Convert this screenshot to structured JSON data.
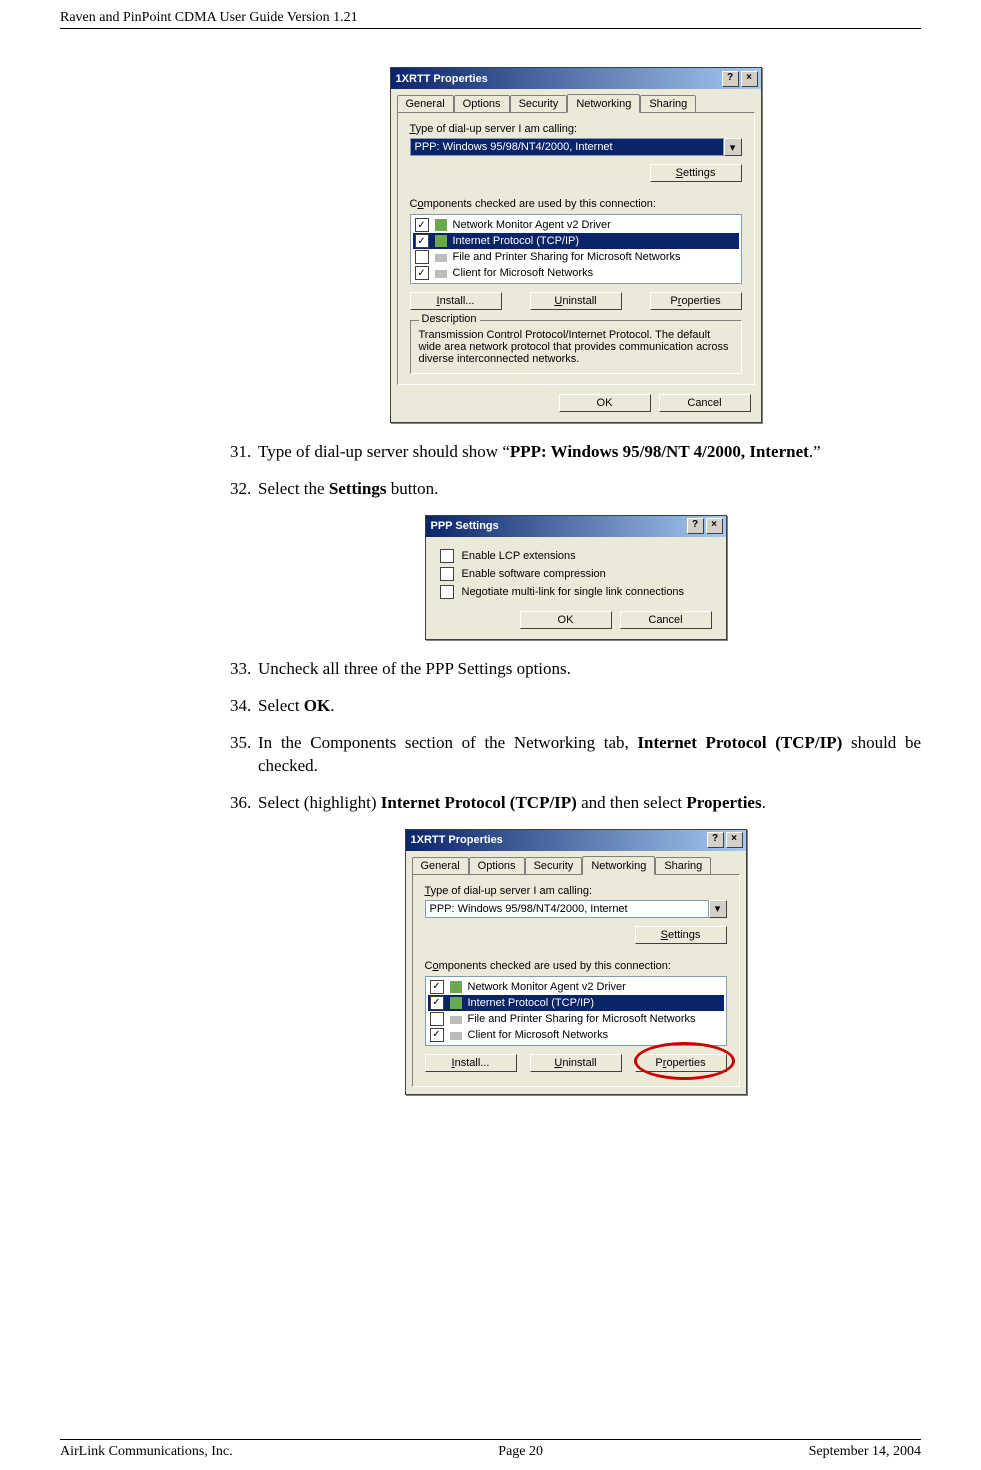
{
  "header": {
    "title": "Raven and PinPoint CDMA User Guide Version 1.21"
  },
  "footer": {
    "left": "AirLink Communications, Inc.",
    "center": "Page 20",
    "right": "September 14, 2004"
  },
  "steps": {
    "s31_pre": "Type of dial-up server should show “",
    "s31_bold": "PPP: Windows 95/98/NT 4/2000, Internet",
    "s31_post": ".”",
    "s32_pre": "Select the ",
    "s32_bold": "Settings",
    "s32_post": " button.",
    "s33": "Uncheck all three of the PPP Settings options.",
    "s34_pre": "Select ",
    "s34_bold": "OK",
    "s34_post": ".",
    "s35_pre": "In the Components section of the Networking tab, ",
    "s35_bold": "Internet Protocol (TCP/IP)",
    "s35_post": " should be checked.",
    "s36_a": "Select (highlight) ",
    "s36_b": "Internet Protocol (TCP/IP)",
    "s36_c": " and then select ",
    "s36_d": "Properties",
    "s36_e": "."
  },
  "dlg1": {
    "title": "1XRTT Properties",
    "tabs": [
      "General",
      "Options",
      "Security",
      "Networking",
      "Sharing"
    ],
    "label_type": "Type of dial-up server I am calling:",
    "dropdown": "PPP: Windows 95/98/NT4/2000, Internet",
    "settings_btn": "Settings",
    "label_components": "Components checked are used by this connection:",
    "rows": [
      {
        "checked": true,
        "label": "Network Monitor Agent v2 Driver"
      },
      {
        "checked": true,
        "label": "Internet Protocol (TCP/IP)",
        "selected": true
      },
      {
        "checked": false,
        "label": "File and Printer Sharing for Microsoft Networks"
      },
      {
        "checked": true,
        "label": "Client for Microsoft Networks"
      }
    ],
    "btn_install": "Install...",
    "btn_uninstall": "Uninstall",
    "btn_properties": "Properties",
    "desc_title": "Description",
    "desc_body": "Transmission Control Protocol/Internet Protocol. The default wide area network protocol that provides communication across diverse interconnected networks.",
    "ok": "OK",
    "cancel": "Cancel"
  },
  "dlg2": {
    "title": "PPP Settings",
    "chk1": "Enable LCP extensions",
    "chk2": "Enable software compression",
    "chk3": "Negotiate multi-link for single link connections",
    "ok": "OK",
    "cancel": "Cancel"
  }
}
